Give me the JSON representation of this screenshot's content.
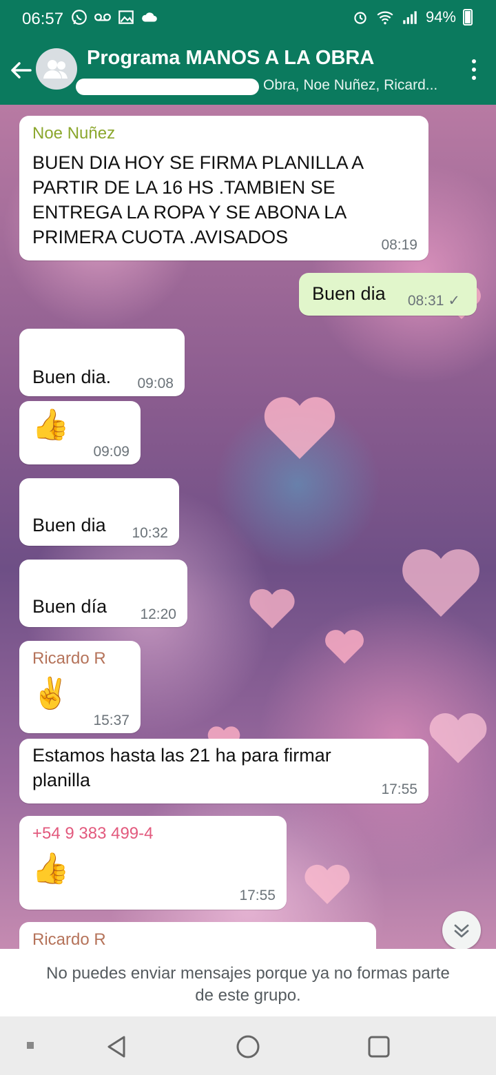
{
  "status_bar": {
    "time": "06:57",
    "battery": "94%"
  },
  "header": {
    "title": "Programa MANOS A LA OBRA",
    "subtitle": "Obra, Noe Nuñez, Ricard..."
  },
  "messages": [
    {
      "sender": "Noe Nuñez",
      "sender_color": "#8ba72d",
      "text_lines": [
        "BUEN DIA HOY SE FIRMA PLANILLA A",
        "PARTIR DE LA 16 HS .TAMBIEN SE",
        "ENTREGA LA ROPA Y SE ABONA LA",
        "PRIMERA CUOTA .AVISADOS"
      ],
      "time": "08:19"
    },
    {
      "text": "Buen dia",
      "time": "08:31",
      "outgoing": true,
      "status": "✓"
    },
    {
      "text": "Buen dia.",
      "time": "09:08"
    },
    {
      "text": "👍",
      "time": "09:09"
    },
    {
      "text": "Buen dia",
      "time": "10:32"
    },
    {
      "text": "Buen día",
      "time": "12:20"
    },
    {
      "sender": "Ricardo R",
      "sender_color": "#b5735a",
      "text": "✌️",
      "time": "15:37"
    },
    {
      "text_lines": [
        "Estamos hasta las 21 ha para firmar",
        "planilla"
      ],
      "time": "17:55"
    },
    {
      "sender": "+54 9 383 499-4",
      "sender_color": "#e2597d",
      "text": "👍",
      "time": "17:55"
    },
    {
      "sender": "Ricardo R",
      "sender_color": "#b5735a"
    }
  ],
  "footer": {
    "notice_line1": "No puedes enviar mensajes porque ya no formas parte",
    "notice_line2": "de este grupo."
  },
  "colors": {
    "header_bg": "#0b7a5e",
    "outgoing_bubble": "#e1f6cb",
    "incoming_bubble": "#ffffff"
  },
  "icons": [
    "back-arrow-icon",
    "group-avatar-icon",
    "more-vert-icon",
    "scroll-down-icon",
    "whatsapp-icon",
    "voicemail-icon",
    "image-icon",
    "cloud-icon",
    "alarm-icon",
    "wifi-icon",
    "signal-icon",
    "battery-icon"
  ]
}
